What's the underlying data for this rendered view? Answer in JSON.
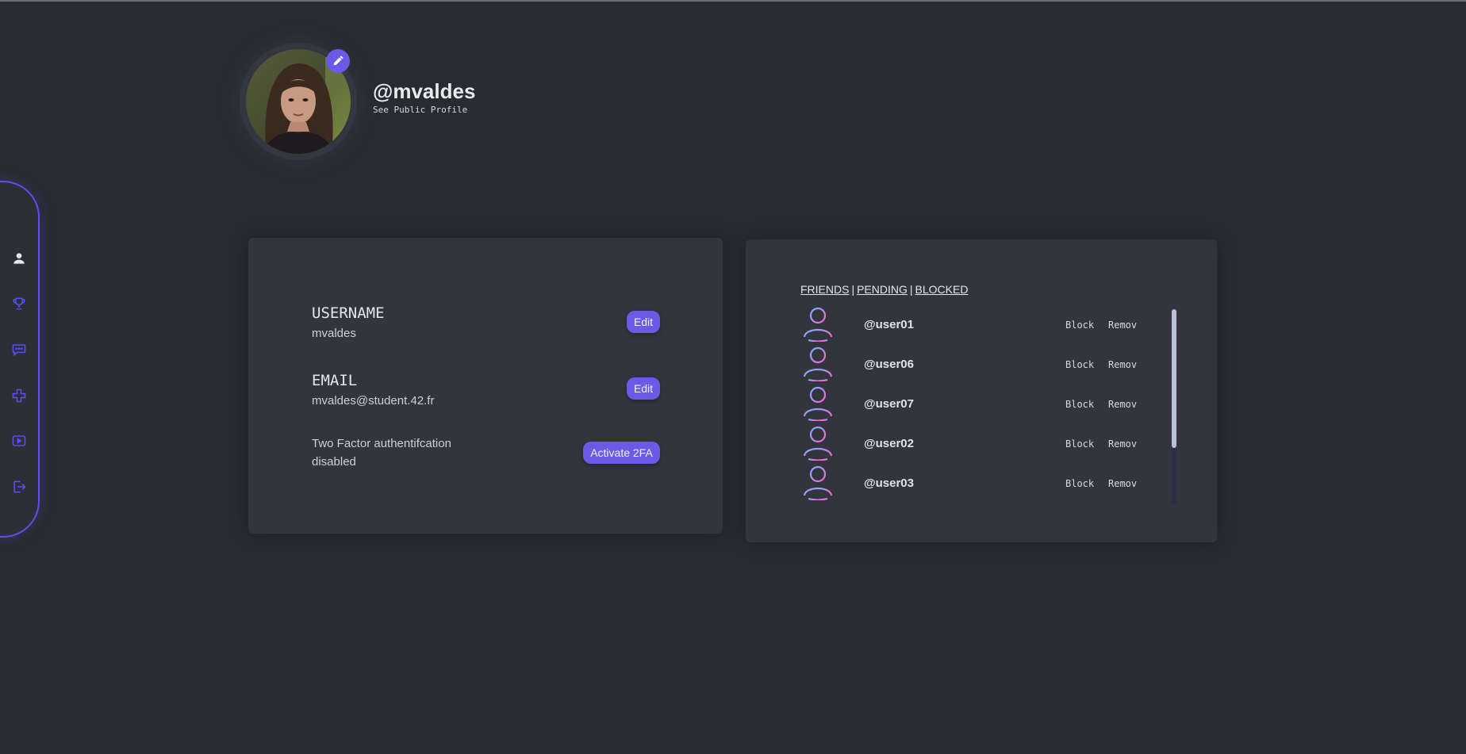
{
  "sidebar": {
    "items": [
      {
        "name": "profile",
        "icon": "person-icon"
      },
      {
        "name": "leaderboard",
        "icon": "trophy-icon"
      },
      {
        "name": "chat",
        "icon": "chat-bubble-icon"
      },
      {
        "name": "play",
        "icon": "gamepad-cross-icon"
      },
      {
        "name": "watch",
        "icon": "play-video-icon"
      },
      {
        "name": "logout",
        "icon": "logout-icon"
      }
    ],
    "accent": "#5a4ff0"
  },
  "profile": {
    "handle": "@mvaldes",
    "public_link": "See Public Profile",
    "edit_icon": "pencil-icon"
  },
  "account": {
    "username_label": "USERNAME",
    "username_value": "mvaldes",
    "email_label": "EMAIL",
    "email_value": "mvaldes@student.42.fr",
    "twofa_title": "Two Factor authentifcation",
    "twofa_status": "disabled",
    "edit_label": "Edit",
    "activate_label": "Activate 2FA"
  },
  "friends": {
    "tabs": [
      "FRIENDS",
      "PENDING",
      "BLOCKED"
    ],
    "separator": "|",
    "block_label": "Block",
    "remove_label": "Remove",
    "list": [
      "@user01",
      "@user06",
      "@user07",
      "@user02",
      "@user03"
    ]
  },
  "colors": {
    "background": "#282b30",
    "panel": "#33353d",
    "button": "#6a5be6"
  }
}
